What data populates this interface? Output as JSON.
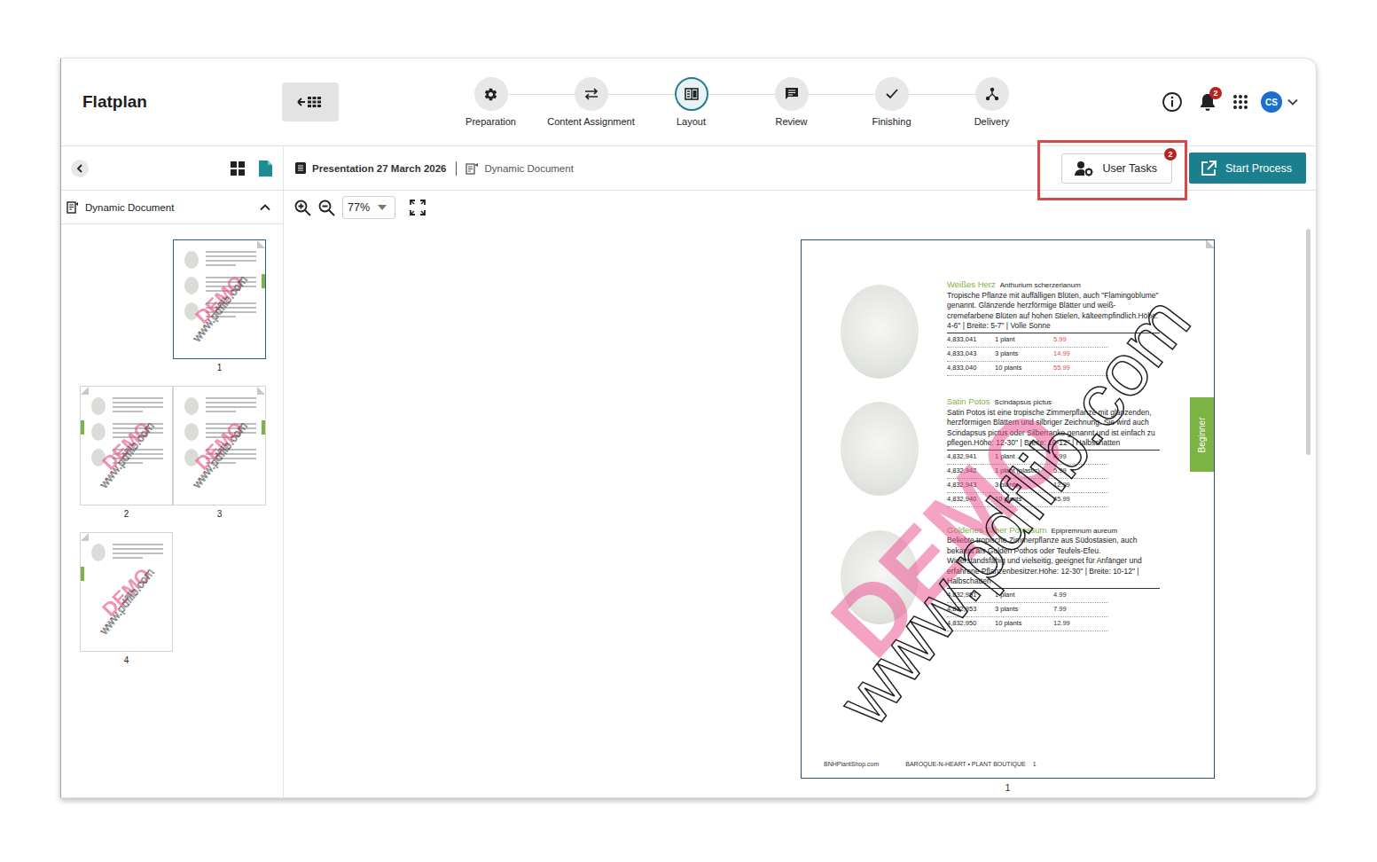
{
  "app": {
    "title": "Flatplan"
  },
  "steps": [
    {
      "label": "Preparation",
      "selected": false
    },
    {
      "label": "Content Assignment",
      "selected": false
    },
    {
      "label": "Layout",
      "selected": true
    },
    {
      "label": "Review",
      "selected": false
    },
    {
      "label": "Finishing",
      "selected": false
    },
    {
      "label": "Delivery",
      "selected": false
    }
  ],
  "header": {
    "notifications": "2",
    "avatar": "CS"
  },
  "sidebar": {
    "section": "Dynamic Document",
    "expanded": true,
    "spreads": [
      {
        "pages": [
          {
            "number": "1",
            "selected": true,
            "position": "right",
            "items": 3
          }
        ]
      },
      {
        "pages": [
          {
            "number": "2",
            "selected": false,
            "position": "left",
            "items": 3
          },
          {
            "number": "3",
            "selected": false,
            "position": "right",
            "items": 3
          }
        ]
      },
      {
        "pages": [
          {
            "number": "4",
            "selected": false,
            "position": "left",
            "items": 1
          }
        ]
      }
    ]
  },
  "breadcrumb": {
    "project": "Presentation 27 March 2026",
    "document": "Dynamic Document"
  },
  "actions": {
    "user_tasks": {
      "label": "User Tasks",
      "badge": "2",
      "highlighted": true
    },
    "start_process": {
      "label": "Start Process"
    }
  },
  "zoom": {
    "value": "77%"
  },
  "watermark": {
    "word": "DEMO",
    "url": "www.pdflib.com"
  },
  "page": {
    "number": "1",
    "side_tab": "Beginner",
    "products": [
      {
        "name": "Weißes Herz",
        "latin": "Anthurium scherzerianum",
        "description": "Tropische Pflanze mit auffälligen Blüten, auch \"Flamingoblume\" genannt. Glänzende herzförmige Blätter und weiß-cremefarbene Blüten auf hohen Stielen, kälteempfindlich.Höhe: 4-6\" | Breite: 5-7\" | Volle Sonne",
        "color": "#d9534f",
        "rows": [
          {
            "sku": "4,833,041",
            "qty": "1 plant",
            "price": "5.99"
          },
          {
            "sku": "4,833,043",
            "qty": "3 plants",
            "price": "14.99"
          },
          {
            "sku": "4,833,040",
            "qty": "10 plants",
            "price": "55.99"
          }
        ]
      },
      {
        "name": "Satin Potos",
        "latin": "Scindapsus pictus",
        "description": "Satin Potos ist eine tropische Zimmerpflanze mit glänzenden, herzförmigen Blättern und silbriger Zeichnung. Sie wird auch Scindapsus pictus oder Silberranke genannt und ist einfach zu pflegen.Höhe: 12-30\" | Breite: 10-12\" | Halbschatten",
        "color": "#333333",
        "rows": [
          {
            "sku": "4,832,941",
            "qty": "1 plant",
            "price": "4.99"
          },
          {
            "sku": "4,832,942",
            "qty": "1 plant (plastic)",
            "price": "5.99"
          },
          {
            "sku": "4,832,943",
            "qty": "3 plants",
            "price": "12.99"
          },
          {
            "sku": "4,832,940",
            "qty": "10 plants",
            "price": "45.99"
          }
        ]
      },
      {
        "name": "Goldenes Silber Potossum",
        "latin": "Epipremnum aureum",
        "description": "Beliebte tropische Zimmerpflanze aus Südostasien, auch bekannt als Golden Pothos oder Teufels-Efeu. Widerstandsfähig und vielseitig, geeignet für Anfänger und erfahrene Pflanzenbesitzer.Höhe: 12-30\" | Breite: 10-12\" | Halbschatten",
        "color": "#333333",
        "rows": [
          {
            "sku": "4,832,951",
            "qty": "1 plant",
            "price": "4.99"
          },
          {
            "sku": "4,832,953",
            "qty": "3 plants",
            "price": "7.99"
          },
          {
            "sku": "4,832,950",
            "qty": "10 plants",
            "price": "12.99"
          }
        ]
      }
    ],
    "footer": {
      "site": "BNHPlantShop.com",
      "brand": "BAROQUE-N-HEART • PLANT BOUTIQUE",
      "page": "1"
    }
  }
}
